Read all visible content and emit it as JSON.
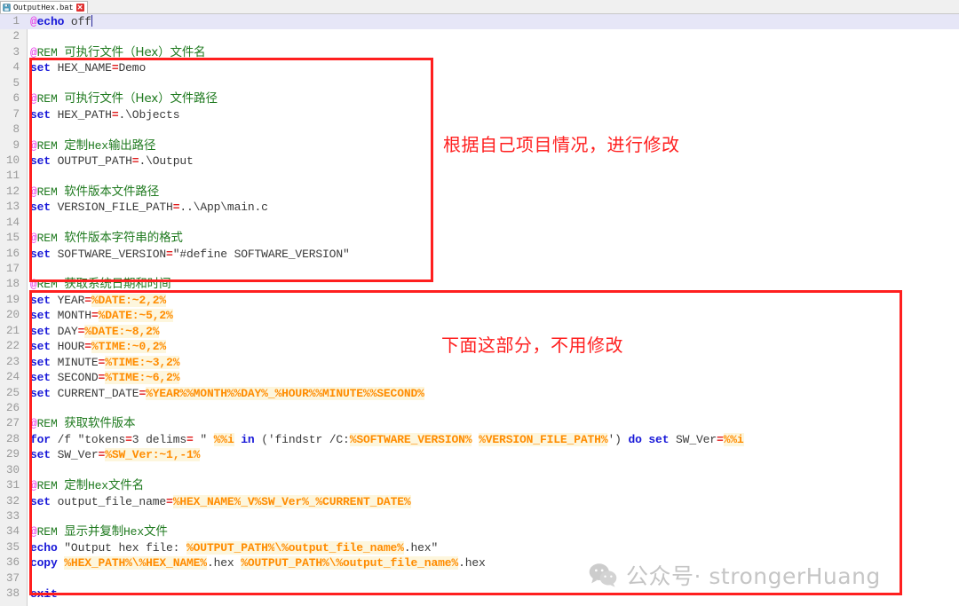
{
  "window": {
    "tab": {
      "icon": "save-floppy-icon",
      "label": "OutputHex.bat",
      "close_label": "✕"
    }
  },
  "editor": {
    "language": "batch",
    "current_line": 1,
    "total_lines": 38,
    "colors": {
      "at_sigil": "#e838e8",
      "keyword": "#1818d8",
      "comment": "#1f7a1f",
      "plain": "#3a3a3a",
      "equals": "#e01b1b",
      "variable": "#ff8c00",
      "variable_bg": "#fdf6dd",
      "annotation_red": "#ff2020",
      "gutter_bg": "#f0f0f0",
      "current_line_bg": "#e6e6f7"
    },
    "lines": [
      {
        "n": "1",
        "tokens": [
          {
            "c": "t-at",
            "t": "@"
          },
          {
            "c": "t-kw",
            "t": "echo"
          },
          {
            "c": "t-plain",
            "t": " off"
          },
          {
            "c": "caret",
            "t": ""
          }
        ]
      },
      {
        "n": "2",
        "tokens": []
      },
      {
        "n": "3",
        "tokens": [
          {
            "c": "t-at",
            "t": "@"
          },
          {
            "c": "t-cmt",
            "t": "REM "
          },
          {
            "c": "t-cmtcn",
            "t": "可执行文件（Hex）文件名"
          }
        ]
      },
      {
        "n": "4",
        "tokens": [
          {
            "c": "t-kw",
            "t": "set"
          },
          {
            "c": "t-plain",
            "t": " HEX_NAME"
          },
          {
            "c": "t-eq",
            "t": "="
          },
          {
            "c": "t-plain",
            "t": "Demo"
          }
        ]
      },
      {
        "n": "5",
        "tokens": []
      },
      {
        "n": "6",
        "tokens": [
          {
            "c": "t-at",
            "t": "@"
          },
          {
            "c": "t-cmt",
            "t": "REM "
          },
          {
            "c": "t-cmtcn",
            "t": "可执行文件（Hex）文件路径"
          }
        ]
      },
      {
        "n": "7",
        "tokens": [
          {
            "c": "t-kw",
            "t": "set"
          },
          {
            "c": "t-plain",
            "t": " HEX_PATH"
          },
          {
            "c": "t-eq",
            "t": "="
          },
          {
            "c": "t-plain",
            "t": ".\\Objects"
          }
        ]
      },
      {
        "n": "8",
        "tokens": []
      },
      {
        "n": "9",
        "tokens": [
          {
            "c": "t-at",
            "t": "@"
          },
          {
            "c": "t-cmt",
            "t": "REM "
          },
          {
            "c": "t-cmtcn",
            "t": "定制"
          },
          {
            "c": "t-cmt",
            "t": "Hex"
          },
          {
            "c": "t-cmtcn",
            "t": "输出路径"
          }
        ]
      },
      {
        "n": "10",
        "tokens": [
          {
            "c": "t-kw",
            "t": "set"
          },
          {
            "c": "t-plain",
            "t": " OUTPUT_PATH"
          },
          {
            "c": "t-eq",
            "t": "="
          },
          {
            "c": "t-plain",
            "t": ".\\Output"
          }
        ]
      },
      {
        "n": "11",
        "tokens": []
      },
      {
        "n": "12",
        "tokens": [
          {
            "c": "t-at",
            "t": "@"
          },
          {
            "c": "t-cmt",
            "t": "REM "
          },
          {
            "c": "t-cmtcn",
            "t": "软件版本文件路径"
          }
        ]
      },
      {
        "n": "13",
        "tokens": [
          {
            "c": "t-kw",
            "t": "set"
          },
          {
            "c": "t-plain",
            "t": " VERSION_FILE_PATH"
          },
          {
            "c": "t-eq",
            "t": "="
          },
          {
            "c": "t-plain",
            "t": "..\\App\\main.c"
          }
        ]
      },
      {
        "n": "14",
        "tokens": []
      },
      {
        "n": "15",
        "tokens": [
          {
            "c": "t-at",
            "t": "@"
          },
          {
            "c": "t-cmt",
            "t": "REM "
          },
          {
            "c": "t-cmtcn",
            "t": "软件版本字符串的格式"
          }
        ]
      },
      {
        "n": "16",
        "tokens": [
          {
            "c": "t-kw",
            "t": "set"
          },
          {
            "c": "t-plain",
            "t": " SOFTWARE_VERSION"
          },
          {
            "c": "t-eq",
            "t": "="
          },
          {
            "c": "t-str",
            "t": "\"#define SOFTWARE_VERSION\""
          }
        ]
      },
      {
        "n": "17",
        "tokens": []
      },
      {
        "n": "18",
        "tokens": [
          {
            "c": "t-at",
            "t": "@"
          },
          {
            "c": "t-cmt",
            "t": "REM "
          },
          {
            "c": "t-cmtcn",
            "t": "获取系统日期和时间"
          }
        ]
      },
      {
        "n": "19",
        "tokens": [
          {
            "c": "t-kw",
            "t": "set"
          },
          {
            "c": "t-plain",
            "t": " YEAR"
          },
          {
            "c": "t-eq",
            "t": "="
          },
          {
            "c": "t-var",
            "t": "%DATE:~2,2%"
          }
        ]
      },
      {
        "n": "20",
        "tokens": [
          {
            "c": "t-kw",
            "t": "set"
          },
          {
            "c": "t-plain",
            "t": " MONTH"
          },
          {
            "c": "t-eq",
            "t": "="
          },
          {
            "c": "t-var",
            "t": "%DATE:~5,2%"
          }
        ]
      },
      {
        "n": "21",
        "tokens": [
          {
            "c": "t-kw",
            "t": "set"
          },
          {
            "c": "t-plain",
            "t": " DAY"
          },
          {
            "c": "t-eq",
            "t": "="
          },
          {
            "c": "t-var",
            "t": "%DATE:~8,2%"
          }
        ]
      },
      {
        "n": "22",
        "tokens": [
          {
            "c": "t-kw",
            "t": "set"
          },
          {
            "c": "t-plain",
            "t": " HOUR"
          },
          {
            "c": "t-eq",
            "t": "="
          },
          {
            "c": "t-var",
            "t": "%TIME:~0,2%"
          }
        ]
      },
      {
        "n": "23",
        "tokens": [
          {
            "c": "t-kw",
            "t": "set"
          },
          {
            "c": "t-plain",
            "t": " MINUTE"
          },
          {
            "c": "t-eq",
            "t": "="
          },
          {
            "c": "t-var",
            "t": "%TIME:~3,2%"
          }
        ]
      },
      {
        "n": "24",
        "tokens": [
          {
            "c": "t-kw",
            "t": "set"
          },
          {
            "c": "t-plain",
            "t": " SECOND"
          },
          {
            "c": "t-eq",
            "t": "="
          },
          {
            "c": "t-var",
            "t": "%TIME:~6,2%"
          }
        ]
      },
      {
        "n": "25",
        "tokens": [
          {
            "c": "t-kw",
            "t": "set"
          },
          {
            "c": "t-plain",
            "t": " CURRENT_DATE"
          },
          {
            "c": "t-eq",
            "t": "="
          },
          {
            "c": "t-var",
            "t": "%YEAR%%MONTH%%DAY%_%HOUR%%MINUTE%%SECOND%"
          }
        ]
      },
      {
        "n": "26",
        "tokens": []
      },
      {
        "n": "27",
        "tokens": [
          {
            "c": "t-at",
            "t": "@"
          },
          {
            "c": "t-cmt",
            "t": "REM "
          },
          {
            "c": "t-cmtcn",
            "t": "获取软件版本"
          }
        ]
      },
      {
        "n": "28",
        "tokens": [
          {
            "c": "t-kw",
            "t": "for"
          },
          {
            "c": "t-plain",
            "t": " /f \"tokens"
          },
          {
            "c": "t-eq",
            "t": "="
          },
          {
            "c": "t-plain",
            "t": "3 delims"
          },
          {
            "c": "t-eq",
            "t": "="
          },
          {
            "c": "t-plain",
            "t": " \" "
          },
          {
            "c": "t-var",
            "t": "%%i"
          },
          {
            "c": "t-plain",
            "t": " "
          },
          {
            "c": "t-kw",
            "t": "in"
          },
          {
            "c": "t-plain",
            "t": " ('findstr /C:"
          },
          {
            "c": "t-var",
            "t": "%SOFTWARE_VERSION%"
          },
          {
            "c": "t-plain",
            "t": " "
          },
          {
            "c": "t-var",
            "t": "%VERSION_FILE_PATH%"
          },
          {
            "c": "t-plain",
            "t": "') "
          },
          {
            "c": "t-kw",
            "t": "do"
          },
          {
            "c": "t-plain",
            "t": " "
          },
          {
            "c": "t-kw",
            "t": "set"
          },
          {
            "c": "t-plain",
            "t": " SW_Ver"
          },
          {
            "c": "t-eq",
            "t": "="
          },
          {
            "c": "t-var",
            "t": "%%i"
          }
        ]
      },
      {
        "n": "29",
        "tokens": [
          {
            "c": "t-kw",
            "t": "set"
          },
          {
            "c": "t-plain",
            "t": " SW_Ver"
          },
          {
            "c": "t-eq",
            "t": "="
          },
          {
            "c": "t-var",
            "t": "%SW_Ver:~1,-1%"
          }
        ]
      },
      {
        "n": "30",
        "tokens": []
      },
      {
        "n": "31",
        "tokens": [
          {
            "c": "t-at",
            "t": "@"
          },
          {
            "c": "t-cmt",
            "t": "REM "
          },
          {
            "c": "t-cmtcn",
            "t": "定制"
          },
          {
            "c": "t-cmt",
            "t": "Hex"
          },
          {
            "c": "t-cmtcn",
            "t": "文件名"
          }
        ]
      },
      {
        "n": "32",
        "tokens": [
          {
            "c": "t-kw",
            "t": "set"
          },
          {
            "c": "t-plain",
            "t": " output_file_name"
          },
          {
            "c": "t-eq",
            "t": "="
          },
          {
            "c": "t-var",
            "t": "%HEX_NAME%"
          },
          {
            "c": "t-var",
            "t": "_V"
          },
          {
            "c": "t-var",
            "t": "%SW_Ver%"
          },
          {
            "c": "t-var",
            "t": "_"
          },
          {
            "c": "t-var",
            "t": "%CURRENT_DATE%"
          }
        ]
      },
      {
        "n": "33",
        "tokens": []
      },
      {
        "n": "34",
        "tokens": [
          {
            "c": "t-at",
            "t": "@"
          },
          {
            "c": "t-cmt",
            "t": "REM "
          },
          {
            "c": "t-cmtcn",
            "t": "显示并复制"
          },
          {
            "c": "t-cmt",
            "t": "Hex"
          },
          {
            "c": "t-cmtcn",
            "t": "文件"
          }
        ]
      },
      {
        "n": "35",
        "tokens": [
          {
            "c": "t-kw",
            "t": "echo"
          },
          {
            "c": "t-plain",
            "t": " \"Output hex file: "
          },
          {
            "c": "t-var",
            "t": "%OUTPUT_PATH%"
          },
          {
            "c": "t-var",
            "t": "\\"
          },
          {
            "c": "t-var",
            "t": "%output_file_name%"
          },
          {
            "c": "t-plain",
            "t": ".hex\""
          }
        ]
      },
      {
        "n": "36",
        "tokens": [
          {
            "c": "t-kw",
            "t": "copy"
          },
          {
            "c": "t-plain",
            "t": " "
          },
          {
            "c": "t-var",
            "t": "%HEX_PATH%"
          },
          {
            "c": "t-var",
            "t": "\\"
          },
          {
            "c": "t-var",
            "t": "%HEX_NAME%"
          },
          {
            "c": "t-plain",
            "t": ".hex "
          },
          {
            "c": "t-var",
            "t": "%OUTPUT_PATH%"
          },
          {
            "c": "t-var",
            "t": "\\"
          },
          {
            "c": "t-var",
            "t": "%output_file_name%"
          },
          {
            "c": "t-plain",
            "t": ".hex"
          }
        ]
      },
      {
        "n": "37",
        "tokens": []
      },
      {
        "n": "38",
        "tokens": [
          {
            "c": "t-kw",
            "t": "exit"
          }
        ]
      }
    ]
  },
  "annotations": [
    {
      "id": "annot-1",
      "text": "根据自己项目情况，进行修改"
    },
    {
      "id": "annot-2",
      "text": "下面这部分，不用修改"
    }
  ],
  "watermark": {
    "icon": "wechat-icon",
    "text": "公众号· strongerHuang"
  }
}
